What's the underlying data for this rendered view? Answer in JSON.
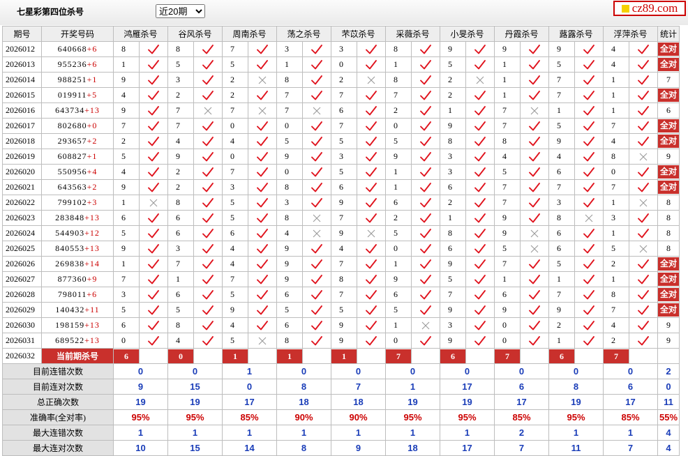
{
  "header": {
    "title": "七星彩第四位杀号",
    "period_selected": "近20期",
    "period_options": [
      "近20期"
    ],
    "logo_text": "cz89.com"
  },
  "columns": {
    "issue": "期号",
    "draw": "开奖号码",
    "stat": "统计"
  },
  "experts": [
    "鸿雁杀号",
    "谷风杀号",
    "周南杀号",
    "荡之杀号",
    "芣苡杀号",
    "采薇杀号",
    "小旻杀号",
    "丹霞杀号",
    "蕗露杀号",
    "浮萍杀号"
  ],
  "rows": [
    {
      "issue": "2026012",
      "draw": "640668",
      "add": "+6",
      "kills": [
        "8",
        "8",
        "7",
        "3",
        "3",
        "8",
        "9",
        "9",
        "9",
        "4"
      ],
      "res": [
        1,
        1,
        1,
        1,
        1,
        1,
        1,
        1,
        1,
        1
      ],
      "stat": "全对"
    },
    {
      "issue": "2026013",
      "draw": "955236",
      "add": "+6",
      "kills": [
        "1",
        "5",
        "5",
        "1",
        "0",
        "1",
        "5",
        "1",
        "5",
        "4"
      ],
      "res": [
        1,
        1,
        1,
        1,
        1,
        1,
        1,
        1,
        1,
        1
      ],
      "stat": "全对"
    },
    {
      "issue": "2026014",
      "draw": "988251",
      "add": "+1",
      "kills": [
        "9",
        "3",
        "2",
        "8",
        "2",
        "8",
        "2",
        "1",
        "7",
        "1"
      ],
      "res": [
        1,
        1,
        0,
        1,
        0,
        1,
        0,
        1,
        1,
        1
      ],
      "stat": "7"
    },
    {
      "issue": "2026015",
      "draw": "019911",
      "add": "+5",
      "kills": [
        "4",
        "2",
        "2",
        "7",
        "7",
        "7",
        "2",
        "1",
        "7",
        "1"
      ],
      "res": [
        1,
        1,
        1,
        1,
        1,
        1,
        1,
        1,
        1,
        1
      ],
      "stat": "全对"
    },
    {
      "issue": "2026016",
      "draw": "643734",
      "add": "+13",
      "kills": [
        "9",
        "7",
        "7",
        "7",
        "6",
        "2",
        "1",
        "7",
        "1",
        "1"
      ],
      "res": [
        1,
        0,
        0,
        0,
        1,
        1,
        1,
        0,
        1,
        1
      ],
      "stat": "6"
    },
    {
      "issue": "2026017",
      "draw": "802680",
      "add": "+0",
      "kills": [
        "7",
        "7",
        "0",
        "0",
        "7",
        "0",
        "9",
        "7",
        "5",
        "7"
      ],
      "res": [
        1,
        1,
        1,
        1,
        1,
        1,
        1,
        1,
        1,
        1
      ],
      "stat": "全对"
    },
    {
      "issue": "2026018",
      "draw": "293657",
      "add": "+2",
      "kills": [
        "2",
        "4",
        "4",
        "5",
        "5",
        "5",
        "8",
        "8",
        "9",
        "4"
      ],
      "res": [
        1,
        1,
        1,
        1,
        1,
        1,
        1,
        1,
        1,
        1
      ],
      "stat": "全对"
    },
    {
      "issue": "2026019",
      "draw": "608827",
      "add": "+1",
      "kills": [
        "5",
        "9",
        "0",
        "9",
        "3",
        "9",
        "3",
        "4",
        "4",
        "8"
      ],
      "res": [
        1,
        1,
        1,
        1,
        1,
        1,
        1,
        1,
        1,
        0
      ],
      "stat": "9"
    },
    {
      "issue": "2026020",
      "draw": "550956",
      "add": "+4",
      "kills": [
        "4",
        "2",
        "7",
        "0",
        "5",
        "1",
        "3",
        "5",
        "6",
        "0"
      ],
      "res": [
        1,
        1,
        1,
        1,
        1,
        1,
        1,
        1,
        1,
        1
      ],
      "stat": "全对"
    },
    {
      "issue": "2026021",
      "draw": "643563",
      "add": "+2",
      "kills": [
        "9",
        "2",
        "3",
        "8",
        "6",
        "1",
        "6",
        "7",
        "7",
        "7"
      ],
      "res": [
        1,
        1,
        1,
        1,
        1,
        1,
        1,
        1,
        1,
        1
      ],
      "stat": "全对"
    },
    {
      "issue": "2026022",
      "draw": "799102",
      "add": "+3",
      "kills": [
        "1",
        "8",
        "5",
        "3",
        "9",
        "6",
        "2",
        "7",
        "3",
        "1"
      ],
      "res": [
        0,
        1,
        1,
        1,
        1,
        1,
        1,
        1,
        1,
        0
      ],
      "stat": "8"
    },
    {
      "issue": "2026023",
      "draw": "283848",
      "add": "+13",
      "kills": [
        "6",
        "6",
        "5",
        "8",
        "7",
        "2",
        "1",
        "9",
        "8",
        "3"
      ],
      "res": [
        1,
        1,
        1,
        0,
        1,
        1,
        1,
        1,
        0,
        1
      ],
      "stat": "8"
    },
    {
      "issue": "2026024",
      "draw": "544903",
      "add": "+12",
      "kills": [
        "5",
        "6",
        "6",
        "4",
        "9",
        "5",
        "8",
        "9",
        "6",
        "1"
      ],
      "res": [
        1,
        1,
        1,
        0,
        0,
        1,
        1,
        0,
        1,
        1
      ],
      "stat": "8"
    },
    {
      "issue": "2026025",
      "draw": "840553",
      "add": "+13",
      "kills": [
        "9",
        "3",
        "4",
        "9",
        "4",
        "0",
        "6",
        "5",
        "6",
        "5"
      ],
      "res": [
        1,
        1,
        1,
        1,
        1,
        1,
        1,
        0,
        1,
        0
      ],
      "stat": "8"
    },
    {
      "issue": "2026026",
      "draw": "269838",
      "add": "+14",
      "kills": [
        "1",
        "7",
        "4",
        "9",
        "7",
        "1",
        "9",
        "7",
        "5",
        "2"
      ],
      "res": [
        1,
        1,
        1,
        1,
        1,
        1,
        1,
        1,
        1,
        1
      ],
      "stat": "全对"
    },
    {
      "issue": "2026027",
      "draw": "877360",
      "add": "+9",
      "kills": [
        "7",
        "1",
        "7",
        "9",
        "8",
        "9",
        "5",
        "1",
        "1",
        "1"
      ],
      "res": [
        1,
        1,
        1,
        1,
        1,
        1,
        1,
        1,
        1,
        1
      ],
      "stat": "全对"
    },
    {
      "issue": "2026028",
      "draw": "798011",
      "add": "+6",
      "kills": [
        "3",
        "6",
        "5",
        "6",
        "7",
        "6",
        "7",
        "6",
        "7",
        "8"
      ],
      "res": [
        1,
        1,
        1,
        1,
        1,
        1,
        1,
        1,
        1,
        1
      ],
      "stat": "全对"
    },
    {
      "issue": "2026029",
      "draw": "140432",
      "add": "+11",
      "kills": [
        "5",
        "5",
        "9",
        "5",
        "5",
        "5",
        "9",
        "9",
        "9",
        "7"
      ],
      "res": [
        1,
        1,
        1,
        1,
        1,
        1,
        1,
        1,
        1,
        1
      ],
      "stat": "全对"
    },
    {
      "issue": "2026030",
      "draw": "198159",
      "add": "+13",
      "kills": [
        "6",
        "8",
        "4",
        "6",
        "9",
        "1",
        "3",
        "0",
        "2",
        "4"
      ],
      "res": [
        1,
        1,
        1,
        1,
        1,
        0,
        1,
        1,
        1,
        1
      ],
      "stat": "9"
    },
    {
      "issue": "2026031",
      "draw": "689522",
      "add": "+13",
      "kills": [
        "0",
        "4",
        "5",
        "8",
        "9",
        "0",
        "9",
        "0",
        "1",
        "2"
      ],
      "res": [
        1,
        1,
        0,
        1,
        1,
        1,
        1,
        1,
        1,
        1
      ],
      "stat": "9"
    }
  ],
  "current": {
    "issue": "2026032",
    "label": "当前期杀号",
    "kills": [
      "6",
      "0",
      "1",
      "1",
      "1",
      "7",
      "6",
      "7",
      "6",
      "7"
    ]
  },
  "summary": [
    {
      "label": "目前连错次数",
      "values": [
        "0",
        "0",
        "1",
        "0",
        "0",
        "0",
        "0",
        "0",
        "0",
        "0"
      ],
      "stat": "2"
    },
    {
      "label": "目前连对次数",
      "values": [
        "9",
        "15",
        "0",
        "8",
        "7",
        "1",
        "17",
        "6",
        "8",
        "6"
      ],
      "stat": "0"
    },
    {
      "label": "总正确次数",
      "values": [
        "19",
        "19",
        "17",
        "18",
        "18",
        "19",
        "19",
        "17",
        "19",
        "17"
      ],
      "stat": "11"
    },
    {
      "label": "准确率(全对率)",
      "values": [
        "95%",
        "95%",
        "85%",
        "90%",
        "90%",
        "95%",
        "95%",
        "85%",
        "95%",
        "85%"
      ],
      "stat": "55%",
      "rate": true
    },
    {
      "label": "最大连错次数",
      "values": [
        "1",
        "1",
        "1",
        "1",
        "1",
        "1",
        "1",
        "2",
        "1",
        "1"
      ],
      "stat": "4"
    },
    {
      "label": "最大连对次数",
      "values": [
        "10",
        "15",
        "14",
        "8",
        "9",
        "18",
        "17",
        "7",
        "11",
        "7"
      ],
      "stat": "4"
    }
  ],
  "colors": {
    "accent_red": "#c9302c",
    "check_red": "#e0141e",
    "cross_gray": "#9a9a9a",
    "stat_blue": "#1a3db8",
    "header_bg": "#eeeeee"
  },
  "icons": {
    "correct": "check-mark-icon",
    "wrong": "cross-mark-icon"
  }
}
